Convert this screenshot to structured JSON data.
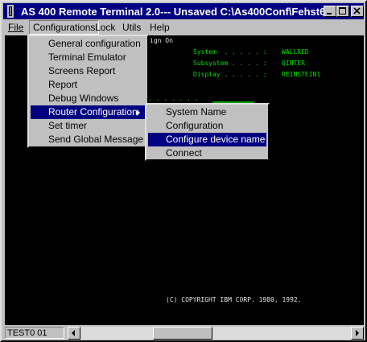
{
  "window": {
    "title": "AS 400 Remote Terminal 2.0--- Unsaved C:\\As400Conf\\Fehst6"
  },
  "menubar": {
    "items": [
      "File",
      "Configurations",
      "Lock",
      "Utils",
      "Help"
    ]
  },
  "configurations_menu": {
    "items": [
      "General configuration",
      "Terminal Emulator",
      "Screens Report",
      "Report",
      "Debug Windows",
      "Router Configuration",
      "Set timer",
      "Send Global Message"
    ]
  },
  "router_submenu": {
    "items": [
      "System Name",
      "Configuration",
      "Configure device name",
      "Connect"
    ]
  },
  "terminal": {
    "signon_fragment": "ign On",
    "system_label": "System  . . . . . :",
    "system_value": "WALLRED",
    "subsystem_label": "Subsystem . . . . :",
    "subsystem_value": "QINTER",
    "display_label": "Display . . . . . :",
    "display_value": "REINSTEIN1",
    "dots": ". . . . . . .",
    "copyright": "(C) COPYRIGHT IBM CORP. 1980, 1992."
  },
  "statusbar": {
    "field": "TEST0 01"
  },
  "colors": {
    "title": "#000080",
    "terminal_bg": "#000000",
    "terminal_text": "#00e000",
    "selection": "#000080"
  }
}
